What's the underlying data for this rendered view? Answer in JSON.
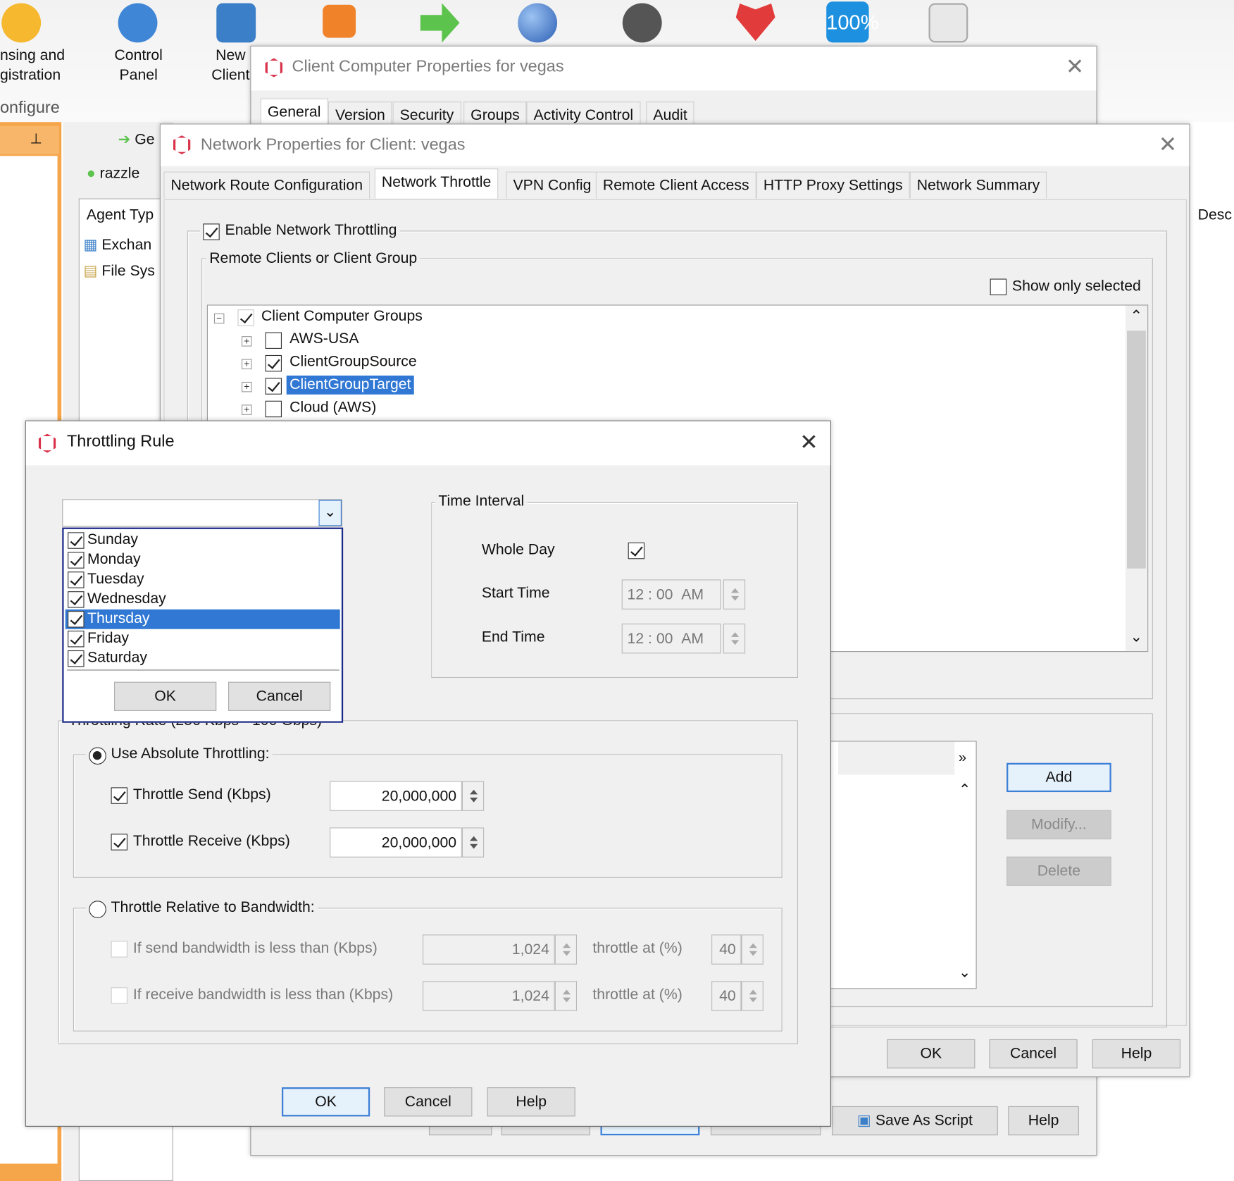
{
  "toolbar": {
    "items": [
      {
        "label1": "nsing and",
        "label2": "gistration",
        "icon": "license-ribbon-icon",
        "color": "#f5b82e"
      },
      {
        "label1": "Control",
        "label2": "Panel",
        "icon": "gear-icon",
        "color": "#3f86d6"
      },
      {
        "label1": "New",
        "label2": "Client",
        "icon": "computer-icon",
        "color": "#3a7fc8"
      },
      {
        "icon": "rss-icon",
        "color": "#f0822a"
      },
      {
        "icon": "green-arrow-icon",
        "color": "#5cc34d"
      },
      {
        "icon": "globe-icon",
        "color": "#2c5fb5"
      },
      {
        "icon": "user-gear-icon",
        "color": "#555555"
      },
      {
        "icon": "heartbeat-icon",
        "color": "#e23b3b"
      },
      {
        "icon": "percent-100-icon",
        "color": "#1e90e0",
        "text": "100%"
      },
      {
        "icon": "report-chart-icon",
        "color": "#888888"
      }
    ],
    "group_label": "onfigure"
  },
  "background": {
    "tab_label": "Ge",
    "client_name": "razzle",
    "agent_type_header": "Agent Typ",
    "agents": [
      "Exchan",
      "File Sys"
    ],
    "desc_header": "Desc"
  },
  "client_props": {
    "title": "Client Computer Properties for vegas",
    "tabs": [
      "General",
      "Version",
      "Security",
      "Groups",
      "Activity Control",
      "Audit"
    ],
    "active_tab": "General",
    "save_as_script": "Save As Script",
    "help": "Help"
  },
  "network_props": {
    "title": "Network Properties for Client: vegas",
    "tabs": [
      "Network Route Configuration",
      "Network Throttle",
      "VPN Config",
      "Remote Client Access",
      "HTTP Proxy Settings",
      "Network Summary"
    ],
    "active_tab": "Network Throttle",
    "enable_label": "Enable Network Throttling",
    "enable_checked": true,
    "remote_group_label": "Remote Clients or Client Group",
    "show_only_selected": "Show only selected",
    "tree": {
      "root": "Client Computer Groups",
      "items": [
        {
          "label": "AWS-USA",
          "checked": false
        },
        {
          "label": "ClientGroupSource",
          "checked": true
        },
        {
          "label": "ClientGroupTarget",
          "checked": true,
          "selected": true
        },
        {
          "label": "Cloud (AWS)",
          "checked": false
        }
      ]
    },
    "add": "Add",
    "modify": "Modify...",
    "delete": "Delete",
    "ok": "OK",
    "cancel": "Cancel",
    "help": "Help"
  },
  "throttling_rule": {
    "title": "Throttling Rule",
    "days": [
      {
        "label": "Sunday",
        "checked": true
      },
      {
        "label": "Monday",
        "checked": true
      },
      {
        "label": "Tuesday",
        "checked": true
      },
      {
        "label": "Wednesday",
        "checked": true
      },
      {
        "label": "Thursday",
        "checked": true,
        "selected": true
      },
      {
        "label": "Friday",
        "checked": true
      },
      {
        "label": "Saturday",
        "checked": true
      }
    ],
    "days_ok": "OK",
    "days_cancel": "Cancel",
    "time_interval": "Time Interval",
    "whole_day": "Whole Day",
    "whole_day_checked": true,
    "start_time_label": "Start Time",
    "end_time_label": "End Time",
    "start_time": {
      "h": "12",
      "m": "00",
      "ampm": "AM"
    },
    "end_time": {
      "h": "12",
      "m": "00",
      "ampm": "AM"
    },
    "rate_label": "Throttling Rate (256 Kbps - 100 Gbps)",
    "absolute": "Use Absolute Throttling:",
    "absolute_selected": true,
    "send_label": "Throttle Send (Kbps)",
    "send_value": "20,000,000",
    "recv_label": "Throttle Receive (Kbps)",
    "recv_value": "20,000,000",
    "relative": "Throttle Relative to Bandwidth:",
    "rel_send_label": "If send bandwidth is less than (Kbps)",
    "rel_send_value": "1,024",
    "rel_recv_label": "If receive bandwidth is less than (Kbps)",
    "rel_recv_value": "1,024",
    "throttle_at": "throttle at (%)",
    "rel_send_pct": "40",
    "rel_recv_pct": "40",
    "ok": "OK",
    "cancel": "Cancel",
    "help": "Help"
  },
  "colors": {
    "selection": "#3078d4",
    "accent_orange": "#f5a54a",
    "app_red": "#d9334b"
  }
}
